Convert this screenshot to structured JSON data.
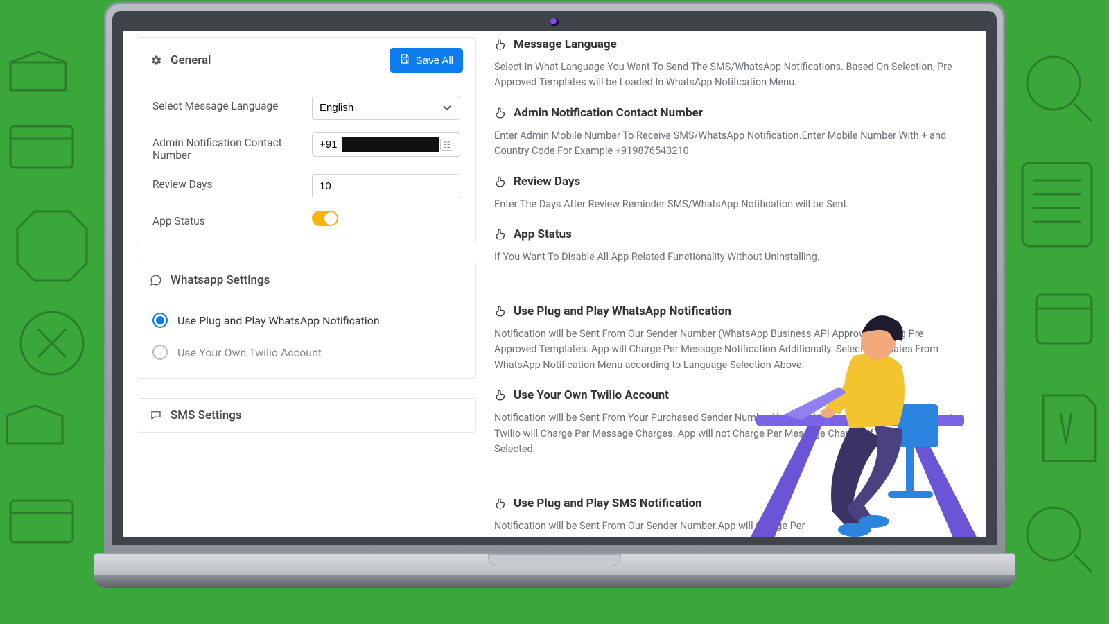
{
  "general": {
    "title": "General",
    "save_label": "Save All",
    "lang_label": "Select Message Language",
    "lang_value": "English",
    "admin_label": "Admin Notification Contact Number",
    "admin_value": "+91",
    "review_label": "Review Days",
    "review_value": "10",
    "status_label": "App Status",
    "status_on": true
  },
  "whatsapp": {
    "title": "Whatsapp Settings",
    "opt1": "Use Plug and Play WhatsApp Notification",
    "opt2": "Use Your Own Twilio Account",
    "selected": 0
  },
  "sms": {
    "title": "SMS Settings"
  },
  "help": {
    "msg_lang": {
      "title": "Message Language",
      "body": "Select In What Language You Want To Send The SMS/WhatsApp Notifications. Based On Selection, Pre Approved Templates will be Loaded In WhatsApp Notification Menu."
    },
    "admin": {
      "title": "Admin Notification Contact Number",
      "body": "Enter Admin Mobile Number To Receive SMS/WhatsApp Notification.Enter Mobile Number With + and Country Code For Example +919876543210"
    },
    "review": {
      "title": "Review Days",
      "body": "Enter The Days After Review Reminder SMS/WhatsApp Notification will be Sent."
    },
    "status": {
      "title": "App Status",
      "body": "If You Want To Disable All App Related Functionality Without Uninstalling."
    },
    "plugplay_wa": {
      "title": "Use Plug and Play WhatsApp Notification",
      "body": "Notification will be Sent From Our Sender Number (WhatsApp Business API Approved) Using Pre Approved Templates. App will Charge Per Message Notification Additionally. Select Templates From WhatsApp Notification Menu according to Language Selection Above."
    },
    "twilio": {
      "title": "Use Your Own Twilio Account",
      "body": "Notification will be Sent From Your Purchased Sender Number.You Need to Fund in Your Twilio Account, Twilio will Charge Per Message Charges. App will not Charge Per Message Charges if This Option Selected."
    },
    "plugplay_sms": {
      "title": "Use Plug and Play SMS Notification",
      "body": "Notification will be Sent From Our Sender Number.App will Charge Per"
    }
  }
}
